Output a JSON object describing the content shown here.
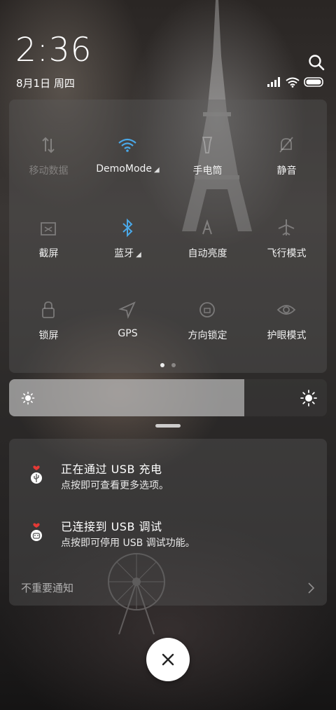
{
  "status": {
    "time": "2:36",
    "date": "8月1日 周四",
    "search_icon": "search-icon",
    "signal_icon": "signal-bars-icon",
    "wifi_icon": "wifi-icon",
    "battery_icon": "battery-icon"
  },
  "quick_settings": {
    "tiles": [
      {
        "label": "移动数据",
        "icon": "mobile-data-icon",
        "active": false
      },
      {
        "label": "DemoMode",
        "icon": "wifi-icon",
        "active": true,
        "has_menu": true
      },
      {
        "label": "手电筒",
        "icon": "flashlight-icon",
        "active": false
      },
      {
        "label": "静音",
        "icon": "bell-off-icon",
        "active": false
      },
      {
        "label": "截屏",
        "icon": "screenshot-icon",
        "active": false
      },
      {
        "label": "蓝牙",
        "icon": "bluetooth-icon",
        "active": true,
        "has_menu": true
      },
      {
        "label": "自动亮度",
        "icon": "auto-brightness-icon",
        "active": false
      },
      {
        "label": "飞行模式",
        "icon": "airplane-icon",
        "active": false
      },
      {
        "label": "锁屏",
        "icon": "lock-icon",
        "active": false
      },
      {
        "label": "GPS",
        "icon": "location-icon",
        "active": false
      },
      {
        "label": "方向锁定",
        "icon": "rotation-lock-icon",
        "active": false
      },
      {
        "label": "护眼模式",
        "icon": "eye-icon",
        "active": false
      }
    ],
    "page_count": 2,
    "current_page": 1,
    "menu_indicator": "◢"
  },
  "brightness": {
    "level": 0.74
  },
  "notifications": [
    {
      "title": "正在通过 USB 充电",
      "subtitle": "点按即可查看更多选项。",
      "icon": "usb-icon"
    },
    {
      "title": "已连接到 USB 调试",
      "subtitle": "点按即可停用 USB 调试功能。",
      "icon": "android-debug-icon"
    }
  ],
  "unimportant_label": "不重要通知",
  "close_icon": "close-icon",
  "colors": {
    "accent": "#4aa8e8",
    "inactive_icon": "rgba(255,255,255,0.3)",
    "usb_heart": "#e53935"
  }
}
